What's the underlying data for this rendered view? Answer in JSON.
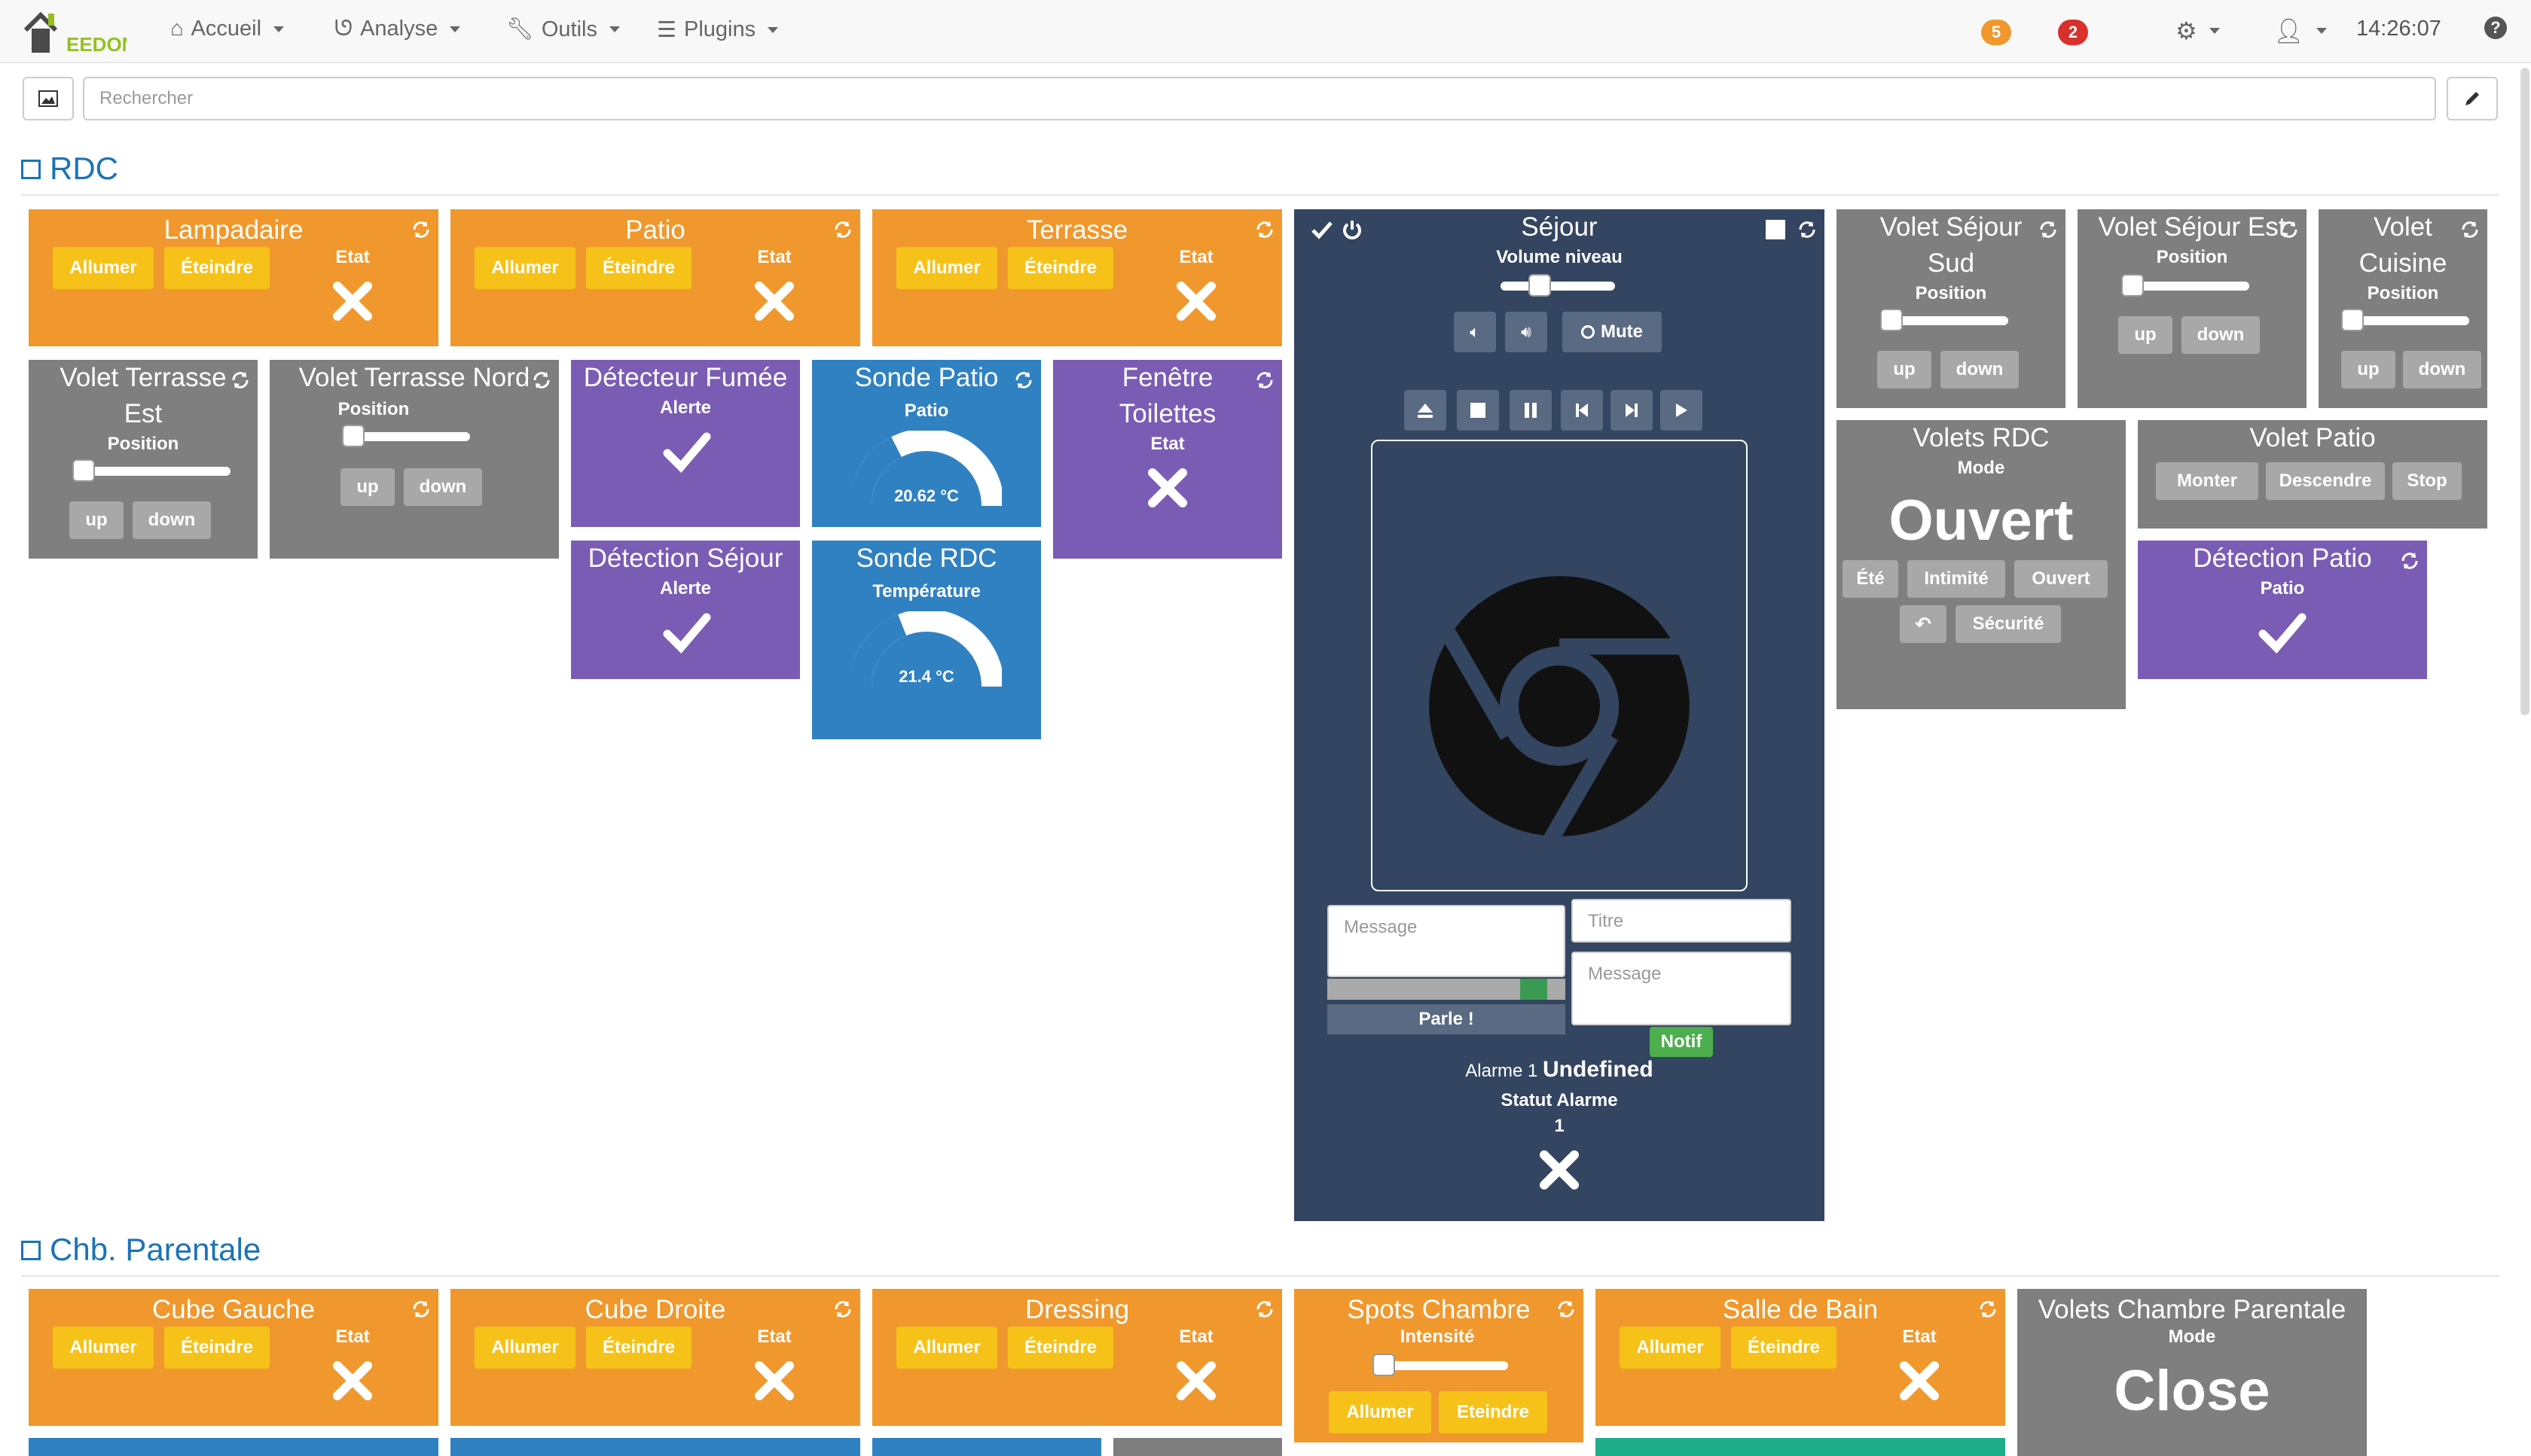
{
  "nav": {
    "logo_text": "EEDOM",
    "accueil": "Accueil",
    "analyse": "Analyse",
    "outils": "Outils",
    "plugins": "Plugins",
    "badge1": "5",
    "badge2": "2",
    "time": "14:26:07"
  },
  "search": {
    "placeholder": "Rechercher"
  },
  "colors": {
    "orange": "#f0982d",
    "grey": "#7f7f7f",
    "purple": "#7a5cb5",
    "blue": "#3081c2",
    "dark": "#334560",
    "yellow_btn": "#f6c21a",
    "link": "#1a73b8"
  },
  "sections": {
    "rdc": "RDC",
    "chb": "Chb. Parentale"
  },
  "common": {
    "allumer": "Allumer",
    "eteindre": "Éteindre",
    "etat": "Etat",
    "position": "Position",
    "up": "up",
    "down": "down",
    "alerte": "Alerte"
  },
  "widgets": {
    "lampadaire": "Lampadaire",
    "patio": "Patio",
    "terrasse": "Terrasse",
    "volet_terrasse_est": "Volet Terrasse Est",
    "volet_terrasse_nord": "Volet Terrasse Nord",
    "detecteur_fumee": "Détecteur Fumée",
    "detection_sejour": "Détection Séjour",
    "sonde_patio": {
      "title": "Sonde Patio",
      "label": "Patio",
      "value": "20.62 °C",
      "level": 0.35
    },
    "sonde_rdc": {
      "title": "Sonde RDC",
      "label": "Température",
      "value": "21.4 °C",
      "level": 0.38
    },
    "fenetre_toilettes": "Fenêtre Toilettes",
    "sejour": {
      "title": "Séjour",
      "volume_label": "Volume niveau",
      "volume_level": 0.3,
      "mute": "Mute",
      "message_placeholder": "Message",
      "titre_placeholder": "Titre",
      "message2_placeholder": "Message",
      "parle": "Parle !",
      "notif": "Notif",
      "alarme_label": "Alarme 1",
      "alarme_value": "Undefined",
      "statut_label": "Statut Alarme",
      "statut_value": "1"
    },
    "volet_sejour_sud": "Volet Séjour Sud",
    "volet_sejour_est": "Volet Séjour Est",
    "volet_cuisine": "Volet Cuisine",
    "volets_rdc": {
      "title": "Volets RDC",
      "mode_label": "Mode",
      "mode_value": "Ouvert",
      "b_ete": "Été",
      "b_intimite": "Intimité",
      "b_ouvert": "Ouvert",
      "b_securite": "Sécurité"
    },
    "volet_patio": {
      "title": "Volet Patio",
      "monter": "Monter",
      "descendre": "Descendre",
      "stop": "Stop"
    },
    "detection_patio": {
      "title": "Détection Patio",
      "label": "Patio"
    },
    "cube_gauche": "Cube Gauche",
    "cube_droite": "Cube Droite",
    "dressing": "Dressing",
    "spots_chambre": {
      "title": "Spots Chambre",
      "label": "Intensité",
      "allumer": "Allumer",
      "eteindre": "Eteindre"
    },
    "salle_de_bain": "Salle de Bain",
    "volets_chambre": {
      "title": "Volets Chambre Parentale",
      "mode_label": "Mode",
      "mode_value": "Close"
    }
  }
}
